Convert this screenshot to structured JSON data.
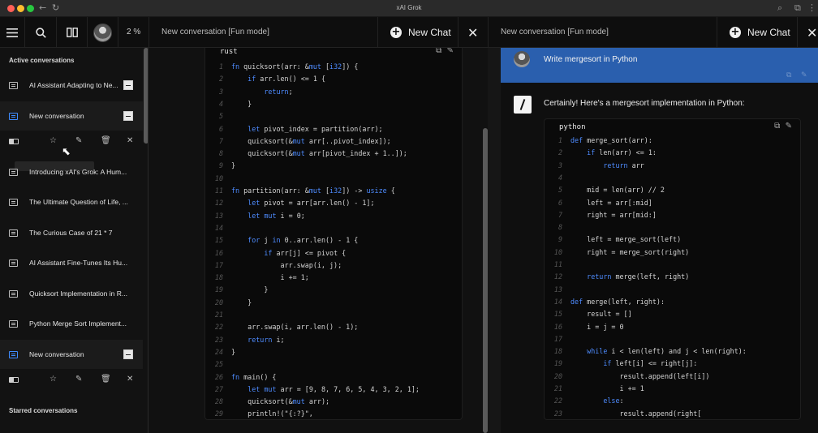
{
  "window": {
    "title": "xAI Grok"
  },
  "header": {
    "zoom": "2 %",
    "left_conversation_title": "New conversation [Fun mode]",
    "right_conversation_title": "New conversation [Fun mode]",
    "new_chat_label": "New Chat"
  },
  "sidebar": {
    "active_heading": "Active conversations",
    "starred_heading": "Starred conversations",
    "items": [
      {
        "label": "AI Assistant Adapting to Ne..."
      },
      {
        "label": "New conversation"
      },
      {
        "label": "Introducing xAI's Grok: A Hum..."
      },
      {
        "label": "The Ultimate Question of Life, ..."
      },
      {
        "label": "The Curious Case of 21 * 7"
      },
      {
        "label": "AI Assistant Fine-Tunes Its Hu..."
      },
      {
        "label": "Quicksort Implementation in R..."
      },
      {
        "label": "Python Merge Sort Implement..."
      },
      {
        "label": "New conversation"
      }
    ]
  },
  "left_code": {
    "language": "rust",
    "lines": [
      {
        "n": "1",
        "code": "fn quicksort(arr: &mut [i32]) {"
      },
      {
        "n": "2",
        "code": "    if arr.len() <= 1 {"
      },
      {
        "n": "3",
        "code": "        return;"
      },
      {
        "n": "4",
        "code": "    }"
      },
      {
        "n": "5",
        "code": ""
      },
      {
        "n": "6",
        "code": "    let pivot_index = partition(arr);"
      },
      {
        "n": "7",
        "code": "    quicksort(&mut arr[..pivot_index]);"
      },
      {
        "n": "8",
        "code": "    quicksort(&mut arr[pivot_index + 1..]);"
      },
      {
        "n": "9",
        "code": "}"
      },
      {
        "n": "10",
        "code": ""
      },
      {
        "n": "11",
        "code": "fn partition(arr: &mut [i32]) -> usize {"
      },
      {
        "n": "12",
        "code": "    let pivot = arr[arr.len() - 1];"
      },
      {
        "n": "13",
        "code": "    let mut i = 0;"
      },
      {
        "n": "14",
        "code": ""
      },
      {
        "n": "15",
        "code": "    for j in 0..arr.len() - 1 {"
      },
      {
        "n": "16",
        "code": "        if arr[j] <= pivot {"
      },
      {
        "n": "17",
        "code": "            arr.swap(i, j);"
      },
      {
        "n": "18",
        "code": "            i += 1;"
      },
      {
        "n": "19",
        "code": "        }"
      },
      {
        "n": "20",
        "code": "    }"
      },
      {
        "n": "21",
        "code": ""
      },
      {
        "n": "22",
        "code": "    arr.swap(i, arr.len() - 1);"
      },
      {
        "n": "23",
        "code": "    return i;"
      },
      {
        "n": "24",
        "code": "}"
      },
      {
        "n": "25",
        "code": ""
      },
      {
        "n": "26",
        "code": "fn main() {"
      },
      {
        "n": "27",
        "code": "    let mut arr = [9, 8, 7, 6, 5, 4, 3, 2, 1];"
      },
      {
        "n": "28",
        "code": "    quicksort(&mut arr);"
      },
      {
        "n": "29",
        "code": "    println!(\"{:?}\","
      }
    ]
  },
  "right_chat": {
    "user_message": "Write mergesort in Python",
    "bot_message": "Certainly! Here's a mergesort implementation in Python:"
  },
  "right_code": {
    "language": "python",
    "lines": [
      {
        "n": "1",
        "code": "def merge_sort(arr):"
      },
      {
        "n": "2",
        "code": "    if len(arr) <= 1:"
      },
      {
        "n": "3",
        "code": "        return arr"
      },
      {
        "n": "4",
        "code": ""
      },
      {
        "n": "5",
        "code": "    mid = len(arr) // 2"
      },
      {
        "n": "6",
        "code": "    left = arr[:mid]"
      },
      {
        "n": "7",
        "code": "    right = arr[mid:]"
      },
      {
        "n": "8",
        "code": ""
      },
      {
        "n": "9",
        "code": "    left = merge_sort(left)"
      },
      {
        "n": "10",
        "code": "    right = merge_sort(right)"
      },
      {
        "n": "11",
        "code": ""
      },
      {
        "n": "12",
        "code": "    return merge(left, right)"
      },
      {
        "n": "13",
        "code": ""
      },
      {
        "n": "14",
        "code": "def merge(left, right):"
      },
      {
        "n": "15",
        "code": "    result = []"
      },
      {
        "n": "16",
        "code": "    i = j = 0"
      },
      {
        "n": "17",
        "code": ""
      },
      {
        "n": "18",
        "code": "    while i < len(left) and j < len(right):"
      },
      {
        "n": "19",
        "code": "        if left[i] <= right[j]:"
      },
      {
        "n": "20",
        "code": "            result.append(left[i])"
      },
      {
        "n": "21",
        "code": "            i += 1"
      },
      {
        "n": "22",
        "code": "        else:"
      },
      {
        "n": "23",
        "code": "            result.append(right["
      }
    ]
  },
  "colors": {
    "accent": "#2a5fae",
    "selected_icon": "#3f8cff",
    "keyword": "#4e8cff"
  },
  "icons": [
    "menu-icon",
    "search-icon",
    "split-view-icon",
    "plus-circle-icon",
    "close-icon",
    "chat-icon",
    "minus-icon",
    "toggle-icon",
    "star-icon",
    "edit-icon",
    "trash-icon",
    "copy-icon",
    "pencil-icon"
  ]
}
